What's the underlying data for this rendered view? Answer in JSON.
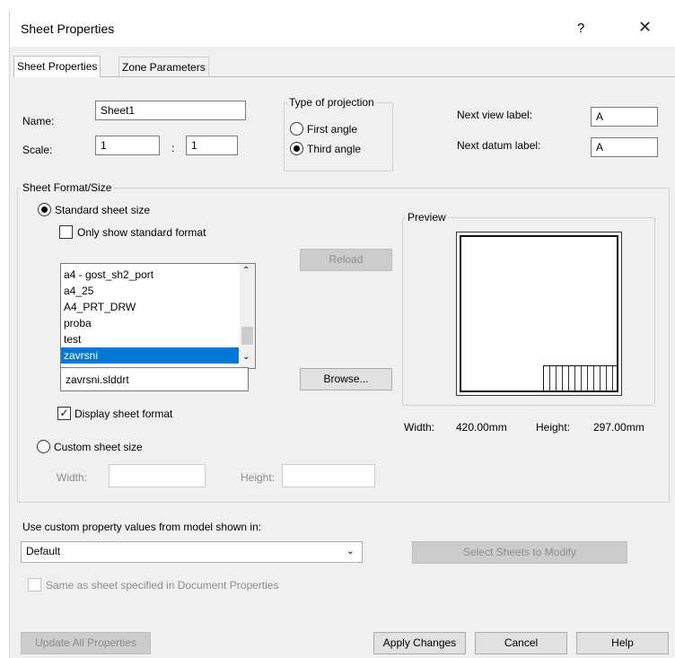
{
  "window": {
    "title": "Sheet Properties",
    "help_glyph": "?",
    "close_glyph": "✕"
  },
  "tabs": [
    {
      "label": "Sheet Properties",
      "active": true
    },
    {
      "label": "Zone Parameters",
      "active": false
    }
  ],
  "sheet": {
    "name_label": "Name:",
    "name_value": "Sheet1",
    "scale_label": "Scale:",
    "scale_left": "1",
    "scale_sep": ":",
    "scale_right": "1"
  },
  "projection": {
    "title": "Type of projection",
    "options": [
      {
        "label": "First angle",
        "selected": false
      },
      {
        "label": "Third angle",
        "selected": true
      }
    ]
  },
  "labels": {
    "next_view_label": "Next view label:",
    "next_view_value": "A",
    "next_datum_label": "Next datum label:",
    "next_datum_value": "A"
  },
  "format": {
    "group_title": "Sheet Format/Size",
    "standard_label": "Standard sheet size",
    "standard_selected": true,
    "only_standard_label": "Only show standard format",
    "only_standard_checked": false,
    "list_items": [
      "a4 - gost_sh2_port",
      "a4_25",
      "A4_PRT_DRW",
      "proba",
      "test",
      "zavrsni"
    ],
    "selected_index": 5,
    "reload_label": "Reload",
    "file_value": "zavrsni.slddrt",
    "browse_label": "Browse...",
    "display_format_label": "Display sheet format",
    "display_format_checked": true,
    "custom_label": "Custom sheet size",
    "custom_selected": false,
    "width_label": "Width:",
    "height_label": "Height:"
  },
  "preview": {
    "title": "Preview",
    "width_label": "Width:",
    "width_value": "420.00mm",
    "height_label": "Height:",
    "height_value": "297.00mm"
  },
  "custom_property": {
    "label": "Use custom property values from model shown in:",
    "dropdown_value": "Default",
    "select_sheets_label": "Select Sheets to Modify",
    "same_as_label": "Same as sheet specified in Document Properties",
    "same_as_checked": false
  },
  "footer": {
    "update_all_label": "Update All Properties",
    "apply_label": "Apply Changes",
    "cancel_label": "Cancel",
    "help_label": "Help"
  }
}
